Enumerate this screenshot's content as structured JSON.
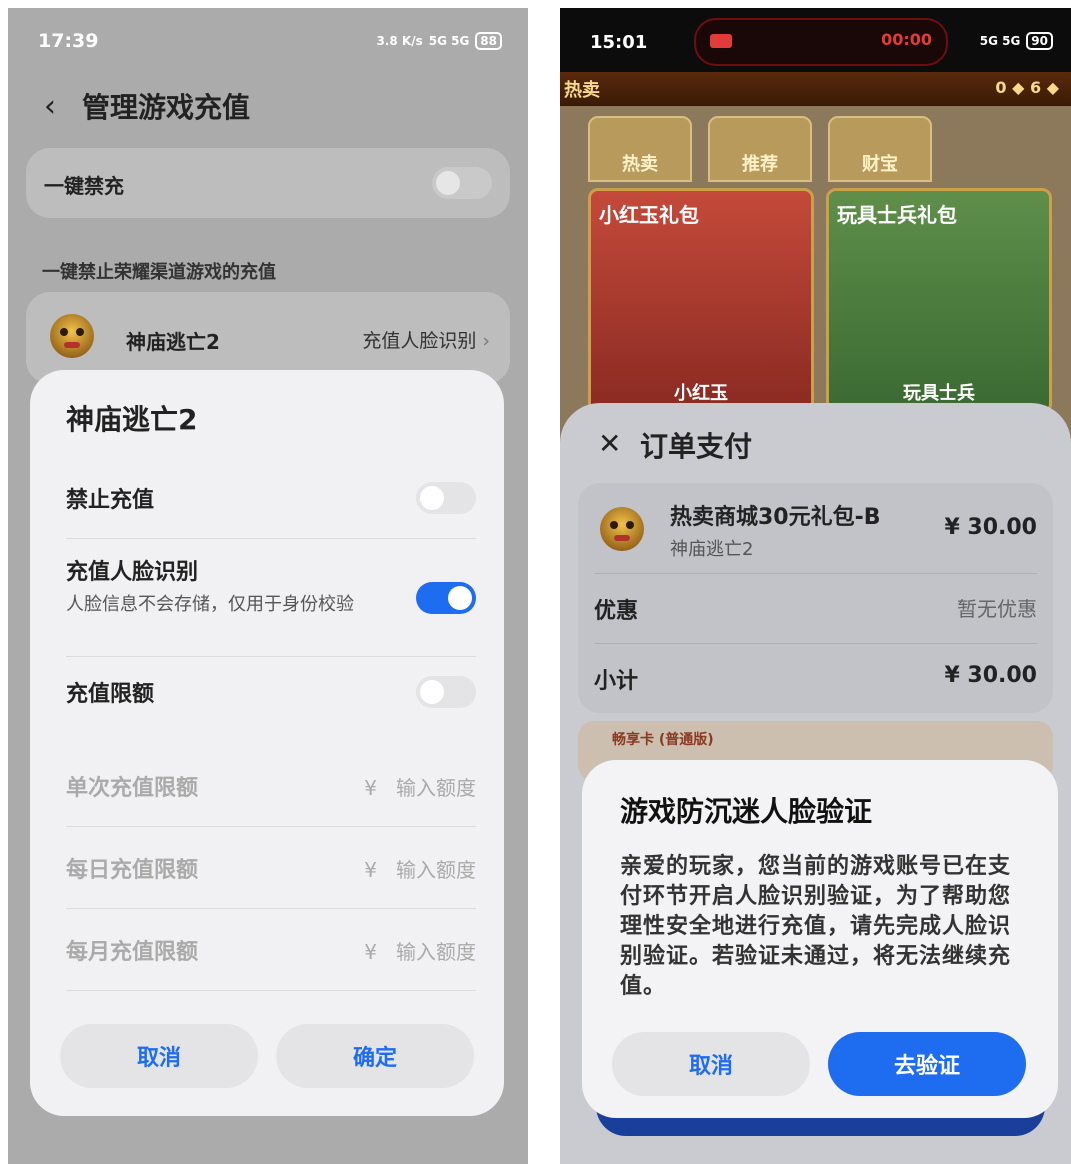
{
  "left": {
    "status": {
      "time": "17:39",
      "speed": "3.8 K/s",
      "network": "5G 5G",
      "battery": "88"
    },
    "header": {
      "back_icon": "chevron-left-icon",
      "title": "管理游戏充值"
    },
    "one_key": {
      "label": "一键禁充"
    },
    "section_label": "一键禁止荣耀渠道游戏的充值",
    "game_row": {
      "name": "神庙逃亡2",
      "action": "充值人脸识别",
      "chevron": "›"
    },
    "sheet": {
      "title": "神庙逃亡2",
      "forbid": {
        "label": "禁止充值",
        "on": false
      },
      "face": {
        "label": "充值人脸识别",
        "sub": "人脸信息不会存储，仅用于身份校验",
        "on": true
      },
      "limit": {
        "label": "充值限额",
        "on": false
      },
      "limits": [
        {
          "label": "单次充值限额",
          "currency": "¥",
          "placeholder": "输入额度"
        },
        {
          "label": "每日充值限额",
          "currency": "¥",
          "placeholder": "输入额度"
        },
        {
          "label": "每月充值限额",
          "currency": "¥",
          "placeholder": "输入额度"
        }
      ],
      "cancel": "取消",
      "confirm": "确定"
    }
  },
  "right": {
    "status": {
      "time": "15:01",
      "rec_time": "00:00",
      "network": "5G 5G",
      "battery": "90"
    },
    "shop": {
      "title": "热卖",
      "currency": "0 ◆ 6 ◆"
    },
    "tabs": [
      "热卖",
      "推荐",
      "财宝"
    ],
    "packs": [
      {
        "title": "小红玉礼包",
        "name": "小红玉"
      },
      {
        "title": "玩具士兵礼包",
        "name": "玩具士兵"
      }
    ],
    "order": {
      "title": "订单支付",
      "item_name": "热卖商城30元礼包-B",
      "item_game": "神庙逃亡2",
      "item_price": "¥ 30.00",
      "discount_label": "优惠",
      "discount_value": "暂无优惠",
      "subtotal_label": "小计",
      "subtotal_value": "¥ 30.00",
      "coupon": "畅享卡 (普通版)"
    },
    "dialog": {
      "title": "游戏防沉迷人脸验证",
      "body": "亲爱的玩家，您当前的游戏账号已在支付环节开启人脸识别验证，为了帮助您理性安全地进行充值，请先完成人脸识别验证。若验证未通过，将无法继续充值。",
      "cancel": "取消",
      "verify": "去验证"
    },
    "colors": {
      "accent": "#1e6cf0"
    }
  }
}
